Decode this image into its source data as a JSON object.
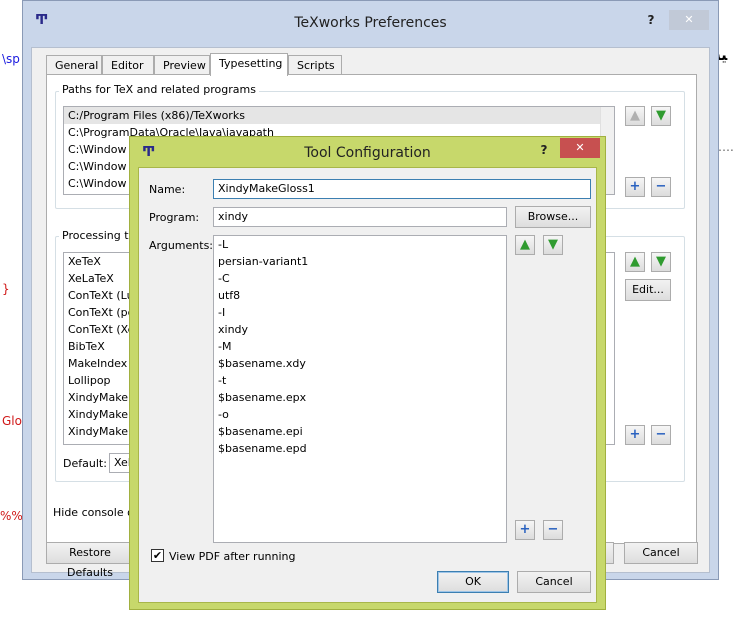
{
  "background": {
    "snippets": [
      "\\sp",
      "}",
      "Glo",
      "%%",
      "ﻴﻪ",
      "…."
    ]
  },
  "preferences": {
    "title": "TeXworks Preferences",
    "help": "?",
    "close": "✕",
    "tabs": [
      {
        "label": "General"
      },
      {
        "label": "Editor"
      },
      {
        "label": "Preview"
      },
      {
        "label": "Typesetting"
      },
      {
        "label": "Scripts"
      }
    ],
    "paths_group_label": "Paths for TeX and related programs",
    "paths": [
      "C:/Program Files (x86)/TeXworks",
      "C:\\ProgramData\\Oracle\\Java\\javapath",
      "C:\\Window",
      "C:\\Window",
      "C:\\Window"
    ],
    "processing_group_label": "Processing too",
    "tools": [
      "XeTeX",
      "XeLaTeX",
      "ConTeXt (Lu",
      "ConTeXt (pc",
      "ConTeXt (Xe",
      "BibTeX",
      "MakeIndex",
      "Lollipop",
      "XindyMake",
      "XindyMake",
      "XindyMake"
    ],
    "edit_button": "Edit...",
    "default_label": "Default:",
    "default_value": "XeL",
    "hide_console_label": "Hide console out",
    "restore_defaults": "Restore Defaults",
    "cancel": "Cancel"
  },
  "tool_config": {
    "title": "Tool Configuration",
    "help": "?",
    "close": "✕",
    "name_label": "Name:",
    "name_value": "XindyMakeGloss1",
    "program_label": "Program:",
    "program_value": "xindy",
    "browse_button": "Browse...",
    "arguments_label": "Arguments:",
    "arguments": [
      "-L",
      "persian-variant1",
      "-C",
      "utf8",
      "-I",
      "xindy",
      "-M",
      "$basename.xdy",
      "-t",
      "$basename.epx",
      "-o",
      "$basename.epi",
      "$basename.epd"
    ],
    "view_pdf_label": "View PDF after running",
    "view_pdf_checked": "✔",
    "ok_button": "OK",
    "cancel_button": "Cancel"
  },
  "icons": {
    "up": "▲",
    "down": "▼",
    "plus": "+",
    "minus": "−",
    "app": "Ͳ"
  }
}
